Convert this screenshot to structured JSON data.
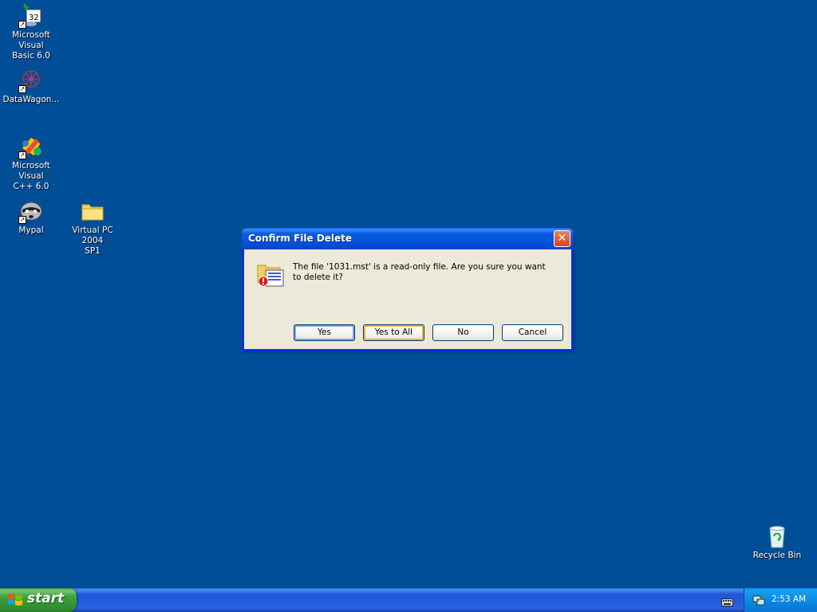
{
  "desktop": {
    "icons": [
      {
        "label_line1": "Microsoft Visual",
        "label_line2": "Basic 6.0",
        "icon": "vb6-icon"
      },
      {
        "label_line1": "DataWagon...",
        "label_line2": "",
        "icon": "datawagon-icon"
      },
      {
        "label_line1": "Microsoft Visual",
        "label_line2": "C++ 6.0",
        "icon": "vcpp-icon"
      },
      {
        "label_line1": "Mypal",
        "label_line2": "",
        "icon": "mypal-icon"
      },
      {
        "label_line1": "Virtual PC 2004",
        "label_line2": "SP1",
        "icon": "folder-icon"
      },
      {
        "label_line1": "Recycle Bin",
        "label_line2": "",
        "icon": "recycle-bin-icon"
      }
    ]
  },
  "dialog": {
    "title": "Confirm File Delete",
    "close_glyph": "✕",
    "message": "The file '1031.mst' is a read-only file. Are you sure you want to delete it?",
    "buttons": {
      "yes": {
        "label": "Yes"
      },
      "yes_to_all": {
        "label": "Yes to All"
      },
      "no": {
        "label": "No"
      },
      "cancel": {
        "label": "Cancel"
      }
    }
  },
  "taskbar": {
    "start_label": "start",
    "clock": "2:53 AM"
  },
  "colors": {
    "desktop_bg": "#004e98",
    "dialog_bg": "#ece9d8",
    "title_blue": "#0551d8",
    "start_green": "#3ea33d"
  }
}
